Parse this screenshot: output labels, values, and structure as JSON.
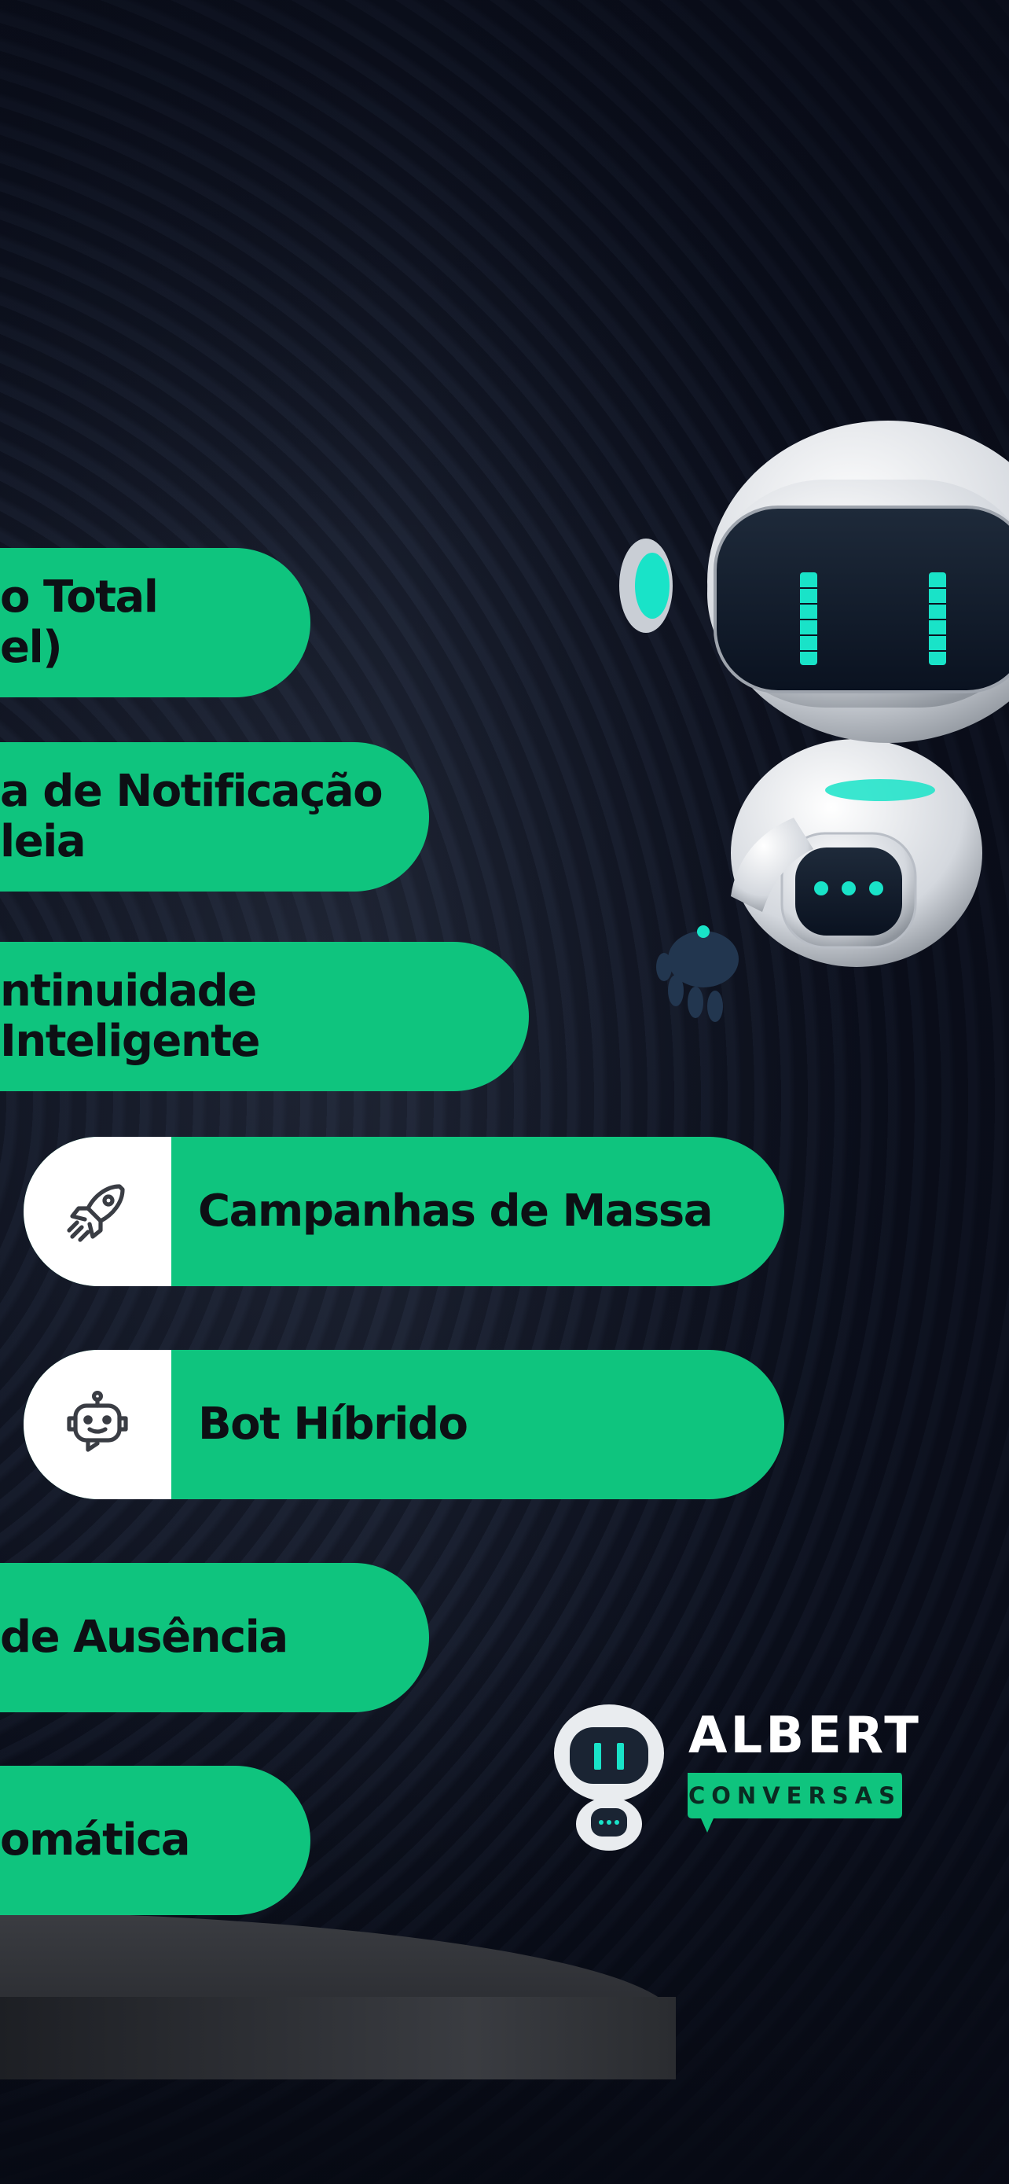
{
  "features": [
    {
      "text": "o Total\nel)",
      "icon": null
    },
    {
      "text": "a de Notificação\nleia",
      "icon": null
    },
    {
      "text": "ntinuidade Inteligente",
      "icon": null
    },
    {
      "text": "Campanhas de Massa",
      "icon": "rocket-icon"
    },
    {
      "text": "Bot Híbrido",
      "icon": "bot-icon"
    },
    {
      "text": " de Ausência",
      "icon": null
    },
    {
      "text": "omática",
      "icon": null
    }
  ],
  "logo": {
    "name": "ALBERT",
    "tagline": "CONVERSAS"
  },
  "colors": {
    "accent": "#0fc47e",
    "background": "#0b0f1c",
    "robot_eye": "#19e3c8"
  }
}
